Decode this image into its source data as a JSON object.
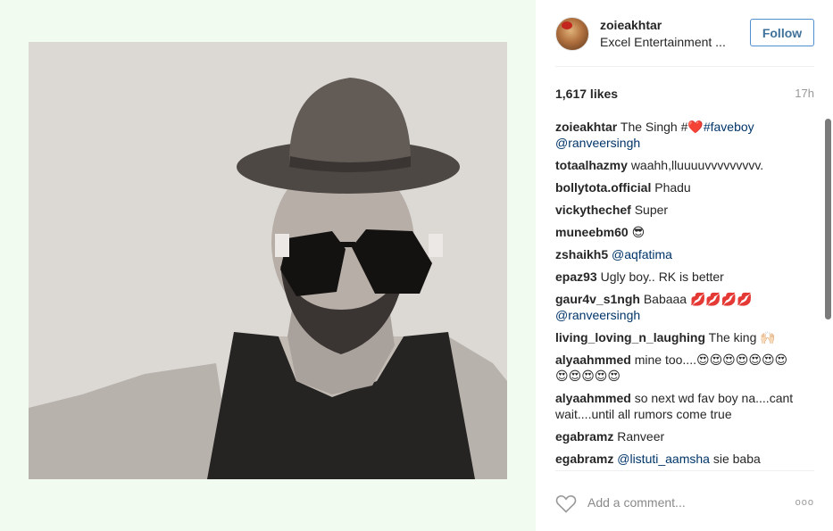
{
  "post": {
    "username": "zoieakhtar",
    "location": "Excel Entertainment ...",
    "follow_label": "Follow",
    "likes": "1,617 likes",
    "time": "17h",
    "comment_placeholder": "Add a comment...",
    "more_label": "ooo"
  },
  "comments": [
    {
      "user": "zoieakhtar",
      "text": "The Singh #",
      "emoji": "❤️",
      "tag": "#faveboy",
      "mention": "@ranveersingh",
      "break_mention": true
    },
    {
      "user": "totaalhazmy",
      "text": "waahh,lluuuuvvvvvvvvv."
    },
    {
      "user": "bollytota.official",
      "text": "Phadu"
    },
    {
      "user": "vickythechef",
      "text": "Super"
    },
    {
      "user": "muneebm60",
      "text": "😎"
    },
    {
      "user": "zshaikh5",
      "mention": "@aqfatima"
    },
    {
      "user": "epaz93",
      "text": "Ugly boy.. RK is better"
    },
    {
      "user": "gaur4v_s1ngh",
      "text": "Babaaa 💋💋💋💋",
      "mention": "@ranveersingh",
      "break_mention": true
    },
    {
      "user": "living_loving_n_laughing",
      "text": "The king 🙌🏻"
    },
    {
      "user": "alyaahmmed",
      "text": "mine too....😍😍😍😍😍😍😍😍😍😍😍😍"
    },
    {
      "user": "alyaahmmed",
      "text": "so next wd fav boy na....cant wait....until all rumors come true"
    },
    {
      "user": "egabramz",
      "text": "Ranveer"
    },
    {
      "user": "egabramz",
      "mention": "@listuti_aamsha",
      "text_after": " sie baba"
    }
  ]
}
